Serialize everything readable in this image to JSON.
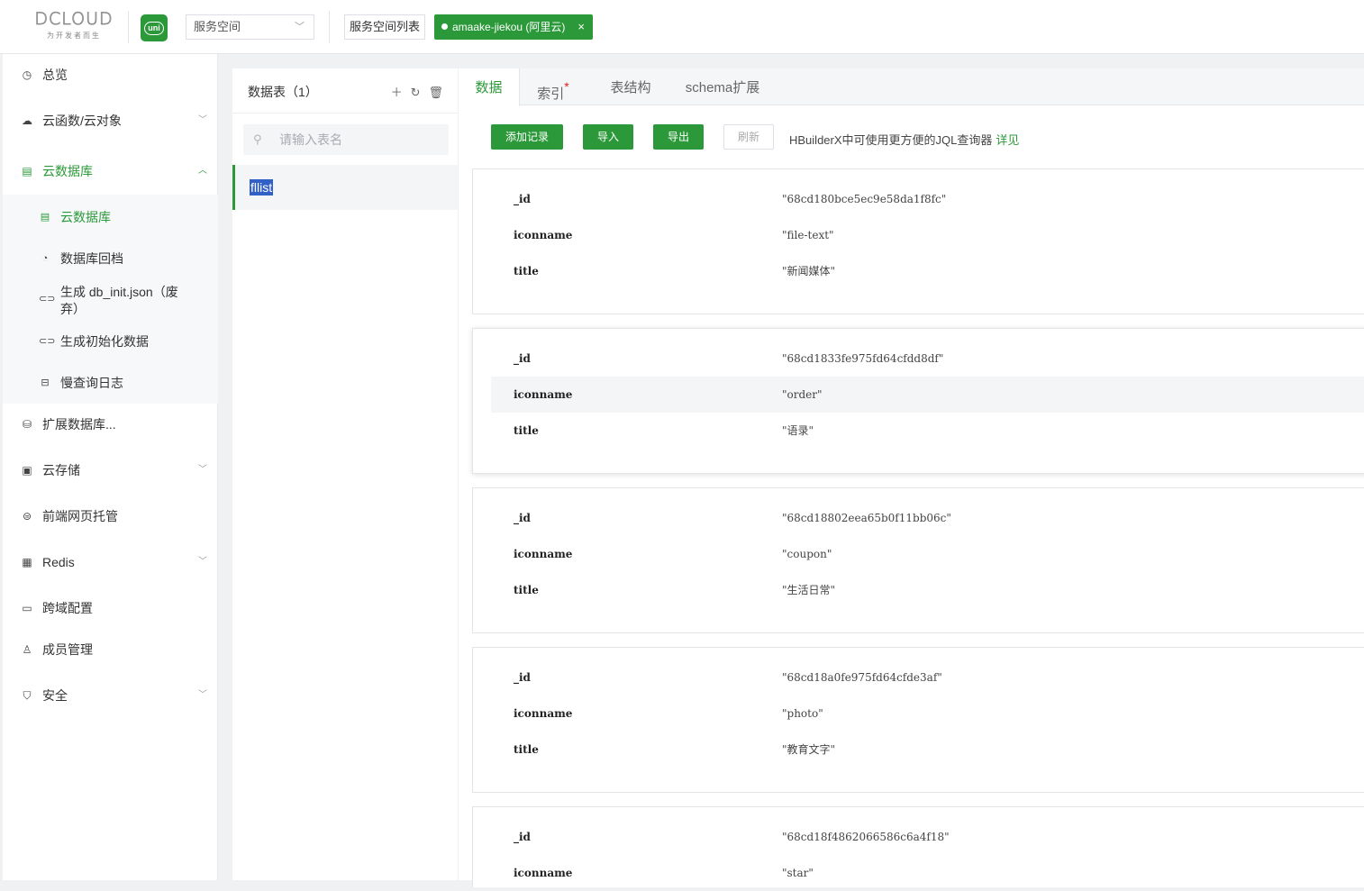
{
  "header": {
    "logo_text": "DCLOUD",
    "logo_tagline": "为开发者而生",
    "uni_badge": "uni",
    "space_select": "服务空间",
    "space_list_button": "服务空间列表",
    "env_tag": "amaake-jiekou (阿里云)",
    "env_close": "×",
    "brand_color": "#2b9939"
  },
  "sidebar": {
    "items": [
      {
        "label": "总览",
        "icon": "dashboard-icon"
      },
      {
        "label": "云函数/云对象",
        "icon": "cloud-function-icon"
      },
      {
        "label": "云数据库",
        "icon": "database-icon"
      },
      {
        "label": "扩展数据库...",
        "icon": "db-stack-icon"
      },
      {
        "label": "云存储",
        "icon": "storage-icon"
      },
      {
        "label": "前端网页托管",
        "icon": "hosting-icon"
      },
      {
        "label": "Redis",
        "icon": "redis-icon"
      },
      {
        "label": "跨域配置",
        "icon": "cors-icon"
      },
      {
        "label": "成员管理",
        "icon": "member-icon"
      },
      {
        "label": "安全",
        "icon": "shield-icon"
      }
    ],
    "sub_items": [
      {
        "label": "云数据库"
      },
      {
        "label": "数据库回档"
      },
      {
        "label": "生成 db_init.json（废弃）"
      },
      {
        "label": "生成初始化数据"
      },
      {
        "label": "慢查询日志"
      }
    ]
  },
  "tables_panel": {
    "title": "数据表（1）",
    "search_placeholder": "请输入表名",
    "tables": [
      "fllist"
    ]
  },
  "content": {
    "tabs": [
      "数据",
      "索引",
      "表结构",
      "schema扩展"
    ],
    "index_marker": "*",
    "buttons": {
      "add": "添加记录",
      "import": "导入",
      "export": "导出",
      "refresh": "刷新"
    },
    "hint": "HBuilderX中可使用更方便的JQL查询器",
    "hint_link": "详见",
    "records": [
      {
        "_id": "\"68cd180bce5ec9e58da1f8fc\"",
        "iconname": "\"file-text\"",
        "title": "\"新闻媒体\""
      },
      {
        "_id": "\"68cd1833fe975fd64cfdd8df\"",
        "iconname": "\"order\"",
        "title": "\"语录\""
      },
      {
        "_id": "\"68cd18802eea65b0f11bb06c\"",
        "iconname": "\"coupon\"",
        "title": "\"生活日常\""
      },
      {
        "_id": "\"68cd18a0fe975fd64cfde3af\"",
        "iconname": "\"photo\"",
        "title": "\"教育文字\""
      },
      {
        "_id": "\"68cd18f4862066586c6a4f18\"",
        "iconname": "\"star\"",
        "title": ""
      }
    ],
    "field_names": [
      "_id",
      "iconname",
      "title"
    ]
  }
}
